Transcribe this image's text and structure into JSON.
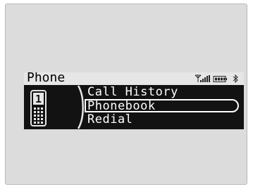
{
  "screen": {
    "title": "Phone",
    "status_icons": [
      "antenna-icon",
      "signal-bars-icon",
      "battery-icon",
      "bluetooth-icon"
    ],
    "phone_icon": {
      "name": "mobile-phone-icon",
      "line_number": "1"
    },
    "menu": {
      "items": [
        {
          "label": "Call History",
          "selected": false
        },
        {
          "label": "Phonebook",
          "selected": true
        },
        {
          "label": "Redial",
          "selected": false
        }
      ]
    }
  },
  "colors": {
    "lcd_background": "#121212",
    "header_background": "#e6e6e6",
    "text": "#ffffff"
  }
}
